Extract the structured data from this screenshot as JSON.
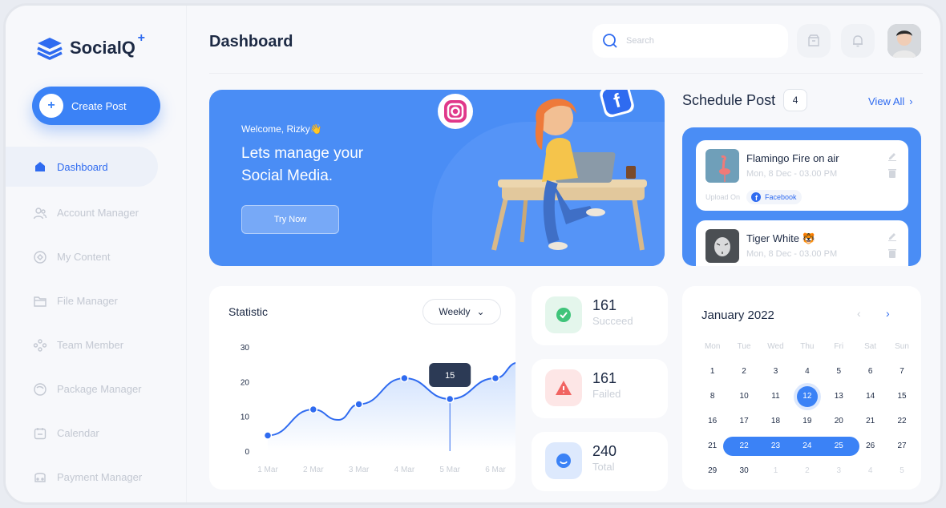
{
  "app": {
    "name": "SocialQ",
    "sup": "+"
  },
  "sidebar": {
    "create_label": "Create Post",
    "items": [
      {
        "label": "Dashboard",
        "icon": "home-icon",
        "active": true
      },
      {
        "label": "Account Manager",
        "icon": "users-icon"
      },
      {
        "label": "My Content",
        "icon": "content-icon"
      },
      {
        "label": "File Manager",
        "icon": "folder-icon"
      },
      {
        "label": "Team Member",
        "icon": "team-icon"
      },
      {
        "label": "Package Manager",
        "icon": "package-icon"
      },
      {
        "label": "Calendar",
        "icon": "calendar-icon"
      },
      {
        "label": "Payment Manager",
        "icon": "wallet-icon"
      }
    ]
  },
  "header": {
    "title": "Dashboard",
    "search_placeholder": "Search"
  },
  "banner": {
    "welcome": "Welcome, Rizky👋",
    "headline": "Lets manage your Social Media.",
    "button": "Try Now"
  },
  "schedule": {
    "title": "Schedule Post",
    "count": "4",
    "view_all": "View All",
    "posts": [
      {
        "title": "Flamingo Fire on air",
        "time": "Mon, 8 Dec - 03.00 PM",
        "upload_on": "Upload On",
        "platform": "Facebook"
      },
      {
        "title": "Tiger White 🐯",
        "time": "Mon, 8 Dec - 03.00 PM"
      }
    ]
  },
  "statistic": {
    "title": "Statistic",
    "period": "Weekly",
    "tooltip": "15"
  },
  "chart_data": {
    "type": "area",
    "x": [
      "1 Mar",
      "2 Mar",
      "3 Mar",
      "4 Mar",
      "5 Mar",
      "6 Mar"
    ],
    "y_ticks": [
      0,
      10,
      20,
      30
    ],
    "ylim": [
      0,
      30
    ],
    "points": [
      {
        "x": 1.0,
        "y": 4.5
      },
      {
        "x": 2.0,
        "y": 12
      },
      {
        "x": 2.55,
        "y": 9
      },
      {
        "x": 3.0,
        "y": 13.5
      },
      {
        "x": 4.0,
        "y": 21
      },
      {
        "x": 5.0,
        "y": 15
      },
      {
        "x": 6.0,
        "y": 21
      },
      {
        "x": 6.5,
        "y": 25.5
      }
    ],
    "markers": [
      0,
      1,
      3,
      4,
      5,
      6
    ],
    "highlight_index": 5,
    "line_color": "#2f6bf0"
  },
  "metrics": [
    {
      "value": "161",
      "label": "Succeed",
      "color": "#3fc47a",
      "icon": "check-icon"
    },
    {
      "value": "161",
      "label": "Failed",
      "color": "#f16462",
      "icon": "warning-icon"
    },
    {
      "value": "240",
      "label": "Total",
      "color": "#3b82f6",
      "icon": "smile-icon"
    }
  ],
  "calendar": {
    "title": "January 2022",
    "weekdays": [
      "Mon",
      "Tue",
      "Wed",
      "Thu",
      "Fri",
      "Sat",
      "Sun"
    ],
    "weeks": [
      [
        "1",
        "2",
        "3",
        "4",
        "5",
        "6",
        "7"
      ],
      [
        "8",
        "10",
        "11",
        "12",
        "13",
        "14",
        "15"
      ],
      [
        "16",
        "17",
        "18",
        "19",
        "20",
        "21",
        "22"
      ],
      [
        "21",
        "22",
        "23",
        "24",
        "25",
        "26",
        "27"
      ],
      [
        "29",
        "30",
        "1",
        "2",
        "3",
        "4",
        "5"
      ]
    ],
    "today": "12",
    "range_week": 3,
    "range_cols": [
      1,
      4
    ],
    "muted_last_week_from": 2
  }
}
